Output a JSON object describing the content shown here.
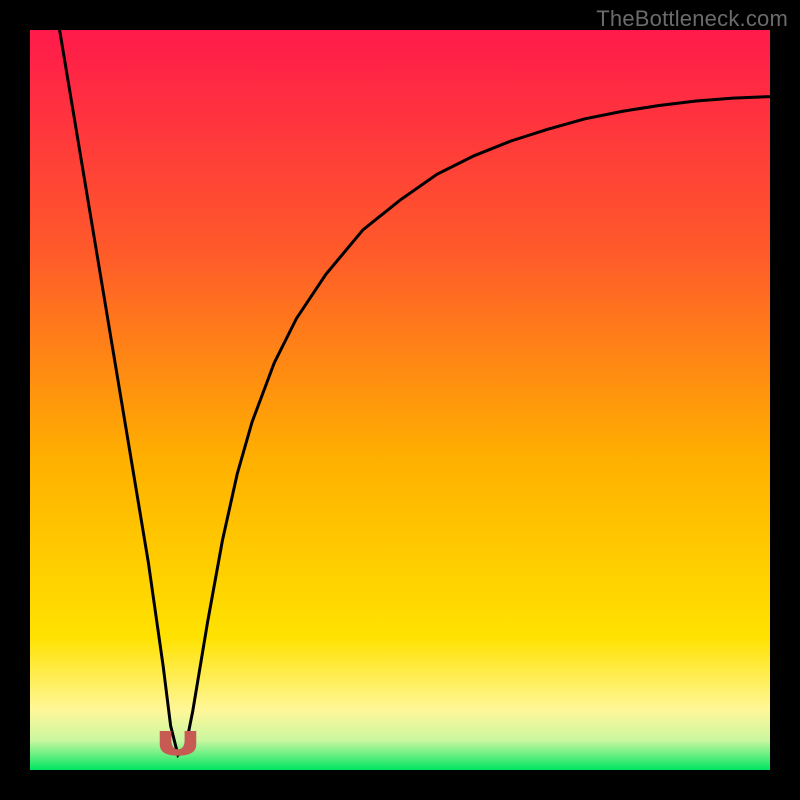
{
  "watermark": "TheBottleneck.com",
  "colors": {
    "frame": "#000000",
    "gradient_top": "#ff1a4b",
    "gradient_mid_upper": "#ff5a2a",
    "gradient_mid": "#ffb000",
    "gradient_mid_lower": "#ffe200",
    "gradient_lower": "#fff79a",
    "gradient_green": "#00e661",
    "curve_stroke": "#000000",
    "marker_fill": "#c85a54",
    "marker_stroke": "#c85a54"
  },
  "chart_data": {
    "type": "line",
    "title": "",
    "xlabel": "",
    "ylabel": "",
    "xlim": [
      0,
      100
    ],
    "ylim": [
      0,
      100
    ],
    "series": [
      {
        "name": "bottleneck-curve",
        "x": [
          4,
          6,
          8,
          10,
          12,
          14,
          16,
          18,
          19,
          20,
          21,
          22,
          24,
          26,
          28,
          30,
          33,
          36,
          40,
          45,
          50,
          55,
          60,
          65,
          70,
          75,
          80,
          85,
          90,
          95,
          100
        ],
        "y": [
          100,
          88,
          76,
          64,
          52,
          40,
          28,
          14,
          6,
          2,
          3,
          8,
          20,
          31,
          40,
          47,
          55,
          61,
          67,
          73,
          77,
          80.5,
          83,
          85,
          86.6,
          88,
          89,
          89.8,
          90.4,
          90.8,
          91
        ]
      }
    ],
    "marker": {
      "name": "minimum-marker",
      "shape": "u",
      "x": 20,
      "y": 2,
      "width_x": 2.4,
      "height_y": 3.2
    },
    "gradient_bands": [
      {
        "y_from": 100,
        "y_to": 70,
        "color_top": "#ff1a4b",
        "color_bottom": "#ff5a2a"
      },
      {
        "y_from": 70,
        "y_to": 40,
        "color_top": "#ff5a2a",
        "color_bottom": "#ffb000"
      },
      {
        "y_from": 40,
        "y_to": 15,
        "color_top": "#ffb000",
        "color_bottom": "#ffe200"
      },
      {
        "y_from": 15,
        "y_to": 5,
        "color_top": "#ffe200",
        "color_bottom": "#fff79a"
      },
      {
        "y_from": 5,
        "y_to": 0,
        "color_top": "#9ff7a0",
        "color_bottom": "#00e661"
      }
    ]
  }
}
